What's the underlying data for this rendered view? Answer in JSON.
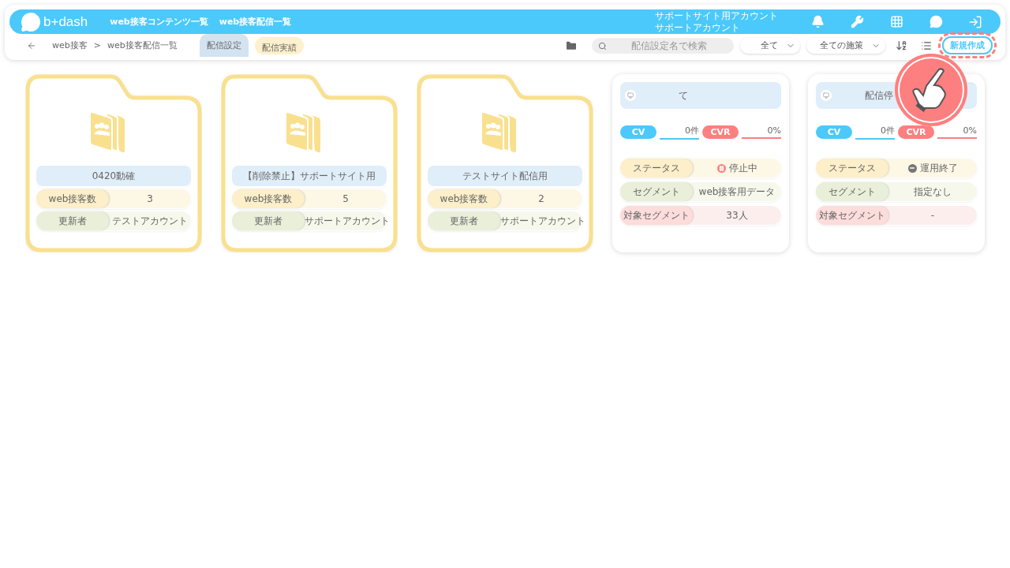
{
  "header": {
    "logo": "b+dash",
    "nav": [
      "web接客コンテンツ一覧",
      "web接客配信一覧"
    ],
    "account": [
      "サポートサイト用アカウント",
      "サポートアカウント"
    ]
  },
  "breadcrumb": [
    "web接客",
    ">",
    "web接客配信一覧"
  ],
  "tabs": [
    {
      "label": "配信設定",
      "selected": true
    },
    {
      "label": "配信実績",
      "selected": false
    }
  ],
  "search": {
    "placeholder": "配信設定名で検索"
  },
  "filters": [
    "全て",
    "全ての施策"
  ],
  "new_button": {
    "label": "新規作成",
    "highlighted": true
  },
  "cards": [
    {
      "kind": "folder",
      "name": "0420動確",
      "rows": [
        {
          "kind": "count",
          "label": "web接客数",
          "value": "3"
        },
        {
          "kind": "user",
          "label": "更新者",
          "value": "テストアカウント"
        }
      ]
    },
    {
      "kind": "folder",
      "name": "【削除禁止】サポートサイト用",
      "rows": [
        {
          "kind": "count",
          "label": "web接客数",
          "value": "5"
        },
        {
          "kind": "user",
          "label": "更新者",
          "value": "サポートアカウント"
        }
      ]
    },
    {
      "kind": "folder",
      "name": "テストサイト配信用",
      "rows": [
        {
          "kind": "count",
          "label": "web接客数",
          "value": "2"
        },
        {
          "kind": "user",
          "label": "更新者",
          "value": "サポートアカウント"
        }
      ]
    },
    {
      "kind": "campaign",
      "name": "て",
      "cv_label": "CV",
      "cv": "0件",
      "cvr_label": "CVR",
      "cvr": "0%",
      "rows": [
        {
          "kind": "status",
          "label": "ステータス",
          "value": "停止中",
          "paused": true
        },
        {
          "kind": "user",
          "label": "セグメント",
          "value": "web接客用データ"
        },
        {
          "kind": "target",
          "label": "対象セグメント",
          "value": "33人"
        }
      ]
    },
    {
      "kind": "campaign",
      "name": "配信停",
      "cv_label": "CV",
      "cv": "0件",
      "cvr_label": "CVR",
      "cvr": "0%",
      "rows": [
        {
          "kind": "status",
          "label": "ステータス",
          "value": "運用終了",
          "paused": false
        },
        {
          "kind": "user",
          "label": "セグメント",
          "value": "指定なし"
        },
        {
          "kind": "target",
          "label": "対象セグメント",
          "value": "-"
        }
      ]
    }
  ]
}
